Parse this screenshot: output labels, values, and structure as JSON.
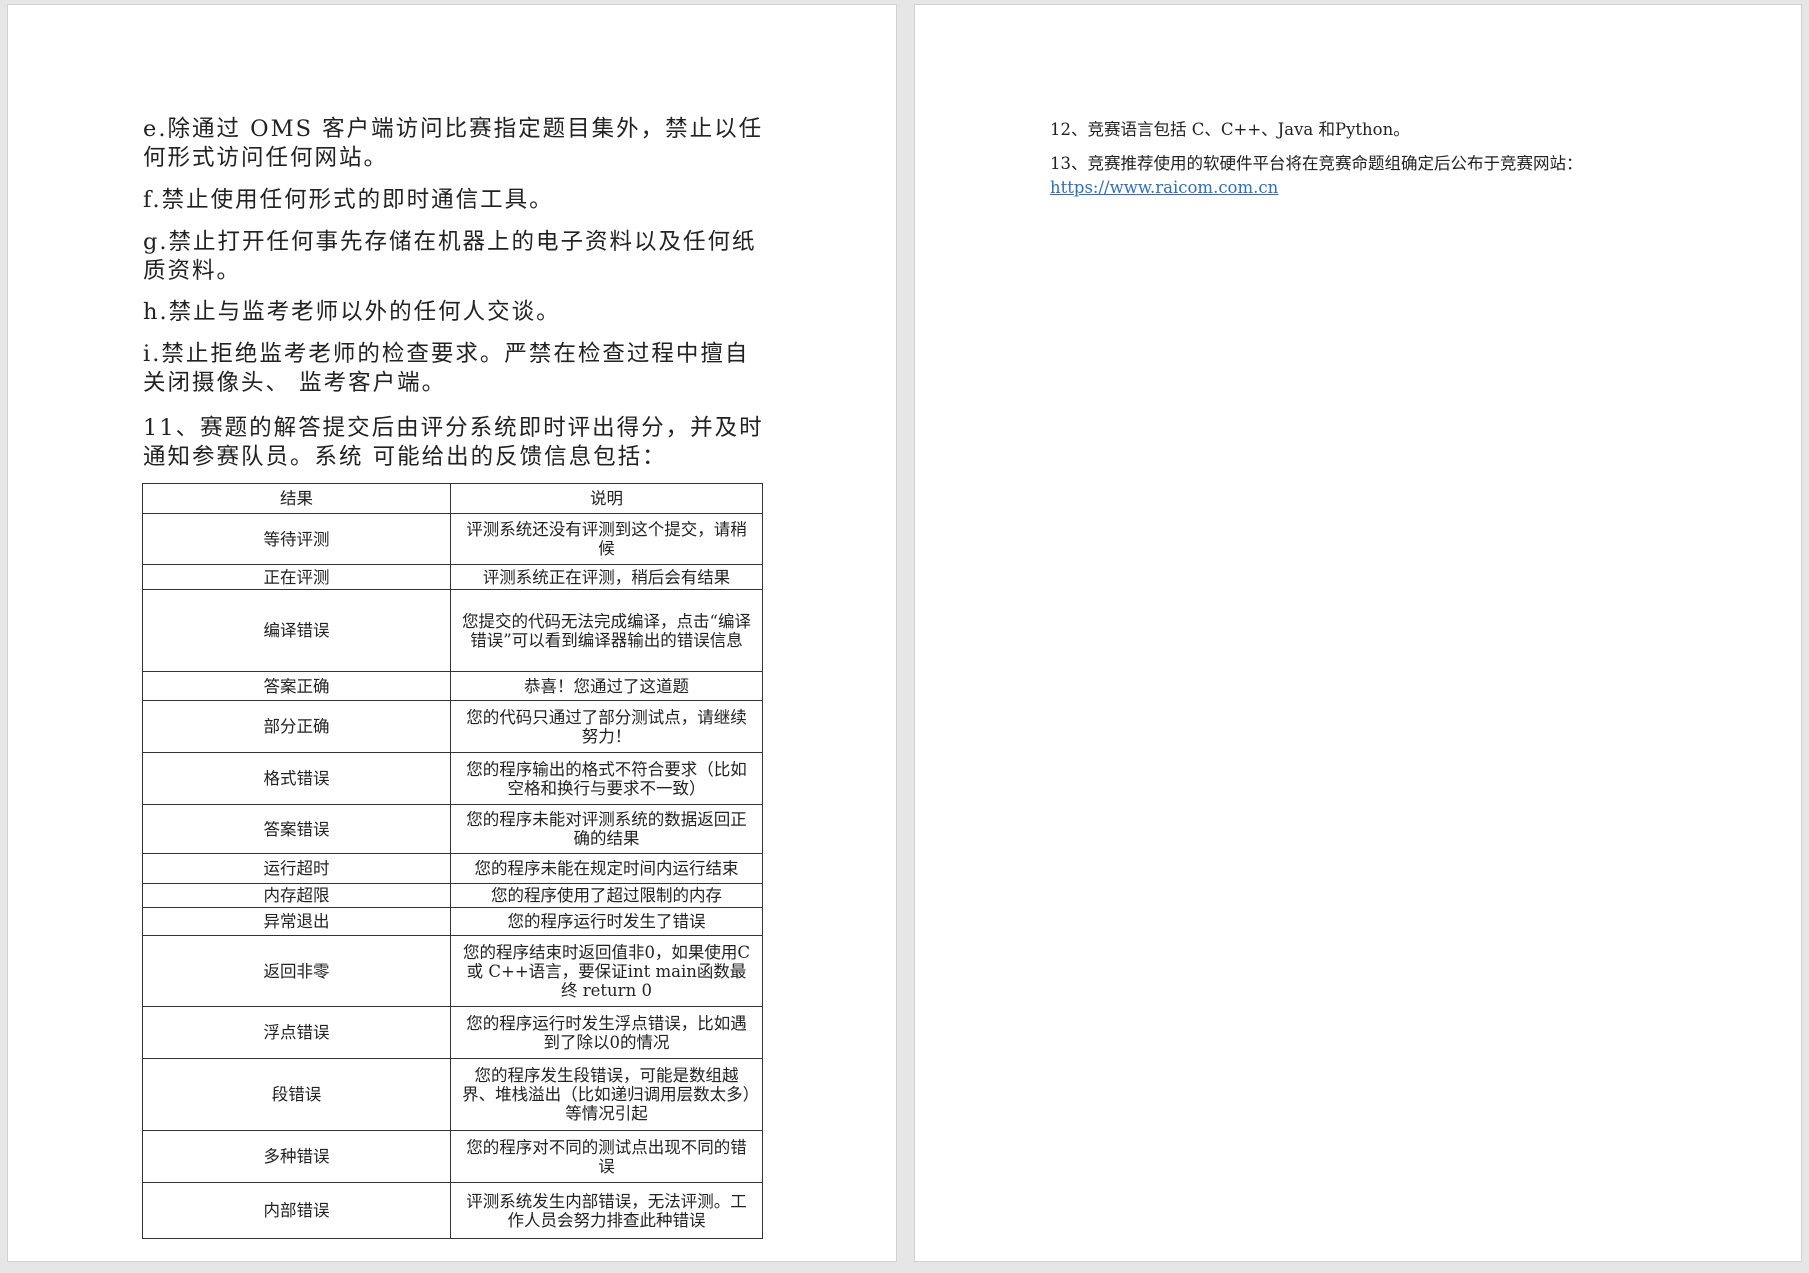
{
  "left_page": {
    "paragraphs": {
      "e": "e.除通过 OMS 客户端访问比赛指定题目集外，禁止以任何形式访问任何网站。",
      "f": "f.禁止使用任何形式的即时通信工具。",
      "g": "g.禁止打开任何事先存储在机器上的电子资料以及任何纸质资料。",
      "h": "h.禁止与监考老师以外的任何人交谈。",
      "i": "i.禁止拒绝监考老师的检查要求。严禁在检查过程中擅自关闭摄像头、 监考客户端。",
      "item11": "11、赛题的解答提交后由评分系统即时评出得分，并及时通知参赛队员。系统 可能给出的反馈信息包括："
    },
    "table": {
      "headers": [
        "结果",
        "说明"
      ],
      "rows": [
        {
          "result": "等待评测",
          "desc": "评测系统还没有评测到这个提交，请稍候"
        },
        {
          "result": "正在评测",
          "desc": "评测系统正在评测，稍后会有结果"
        },
        {
          "result": "编译错误",
          "desc": "您提交的代码无法完成编译，点击“编译错误”可以看到编译器输出的错误信息"
        },
        {
          "result": "答案正确",
          "desc": "恭喜！您通过了这道题"
        },
        {
          "result": "部分正确",
          "desc": "您的代码只通过了部分测试点，请继续努力！"
        },
        {
          "result": "格式错误",
          "desc": "您的程序输出的格式不符合要求（比如空格和换行与要求不一致）"
        },
        {
          "result": "答案错误",
          "desc": "您的程序未能对评测系统的数据返回正确的结果"
        },
        {
          "result": "运行超时",
          "desc": "您的程序未能在规定时间内运行结束"
        },
        {
          "result": "内存超限",
          "desc": "您的程序使用了超过限制的内存"
        },
        {
          "result": "异常退出",
          "desc": "您的程序运行时发生了错误"
        },
        {
          "result": "返回非零",
          "desc": "您的程序结束时返回值非0，如果使用C或 C++语言，要保证int main函数最终 return 0"
        },
        {
          "result": "浮点错误",
          "desc": "您的程序运行时发生浮点错误，比如遇到了除以0的情况"
        },
        {
          "result": "段错误",
          "desc": "您的程序发生段错误，可能是数组越界、堆栈溢出（比如递归调用层数太多）等情况引起"
        },
        {
          "result": "多种错误",
          "desc": "您的程序对不同的测试点出现不同的错误"
        },
        {
          "result": "内部错误",
          "desc": "评测系统发生内部错误，无法评测。工作人员会努力排查此种错误"
        }
      ]
    }
  },
  "right_page": {
    "item12": "12、竞赛语言包括 C、C++、Java 和Python。",
    "item13": "13、竞赛推荐使用的软硬件平台将在竞赛命题组确定后公布于竞赛网站：",
    "link": "https://www.raicom.com.cn"
  },
  "colors": {
    "background": "#e6e6e6",
    "page": "#ffffff",
    "link": "#2a6fc7"
  }
}
